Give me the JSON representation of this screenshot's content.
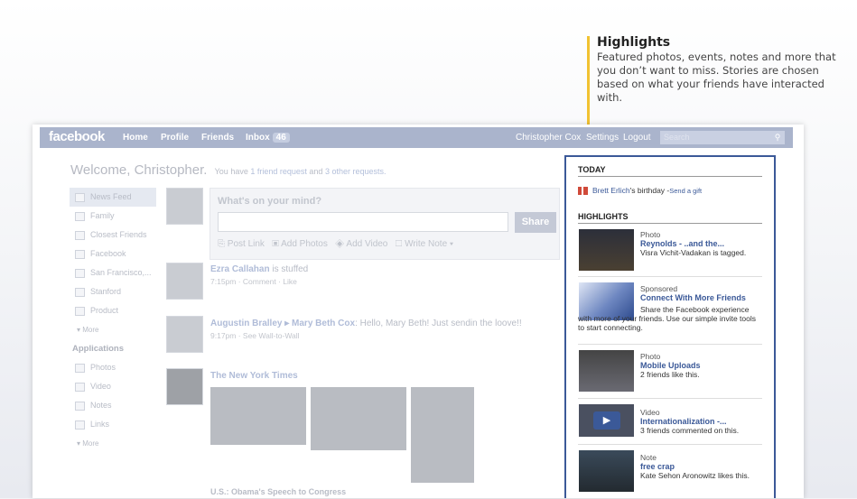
{
  "callout": {
    "title": "Highlights",
    "description": "Featured photos, events, notes and more that you don’t want to miss.  Stories are chosen based on what your friends have interacted with."
  },
  "topbar": {
    "logo": "facebook",
    "nav": [
      "Home",
      "Profile",
      "Friends",
      "Inbox"
    ],
    "inbox_count": "46",
    "user": "Christopher Cox",
    "settings": "Settings",
    "logout": "Logout",
    "search_placeholder": "Search"
  },
  "welcome": {
    "title": "Welcome, Christopher.",
    "pre": "You have",
    "req": "1 friend request",
    "and": "and",
    "other": "3 other requests."
  },
  "leftnav": {
    "items": [
      "News Feed",
      "Family",
      "Closest Friends",
      "Facebook",
      "San Francisco,...",
      "Stanford",
      "Product"
    ],
    "more": "More",
    "apps_header": "Applications",
    "apps": [
      "Photos",
      "Video",
      "Notes",
      "Links"
    ],
    "more2": "More"
  },
  "composer": {
    "prompt": "What's on your mind?",
    "share": "Share",
    "actions": [
      "Post Link",
      "Add Photos",
      "Add Video",
      "Write Note"
    ]
  },
  "stories": [
    {
      "name": "Ezra Callahan",
      "text": "is stuffed",
      "meta": "7:15pm · Comment · Like"
    },
    {
      "name": "Augustin Bralley ▸ Mary Beth Cox",
      "text": ": Hello, Mary Beth! Just sendin the loove!!",
      "meta": "9:17pm · See Wall-to-Wall"
    },
    {
      "name": "The New York Times",
      "caption": "U.S.: Obama's Speech to Congress"
    }
  ],
  "panel": {
    "today_header": "TODAY",
    "bday_name": "Brett Erlich",
    "bday_text": "'s birthday - ",
    "bday_link": "Send a gift",
    "highlights_header": "HIGHLIGHTS",
    "items": [
      {
        "category": "Photo",
        "title": "Reynolds - ..and the...",
        "desc": "Visra Vichit-Vadakan is tagged."
      },
      {
        "category": "Sponsored",
        "title": "Connect With More Friends",
        "desc": "Share the Facebook experience with more of your friends. Use our simple invite tools to start connecting."
      },
      {
        "category": "Photo",
        "title": "Mobile Uploads",
        "desc": "2 friends like this."
      },
      {
        "category": "Video",
        "title": "Internationalization -...",
        "desc": "3 friends commented on this."
      },
      {
        "category": "Note",
        "title": "free crap",
        "desc": "Kate Sehon Aronowitz likes this."
      }
    ]
  }
}
